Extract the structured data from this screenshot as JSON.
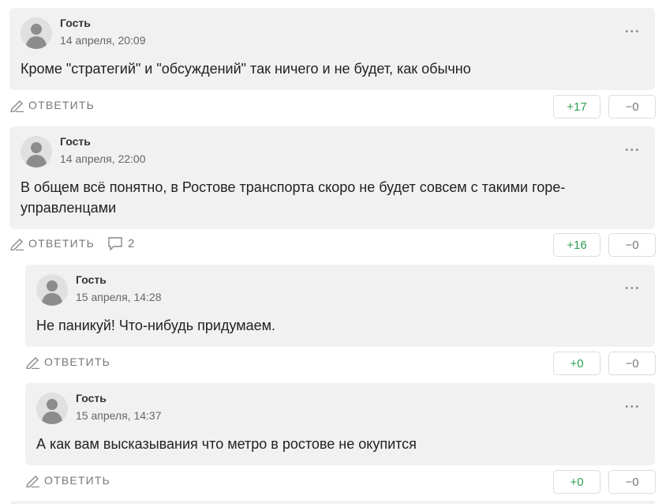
{
  "labels": {
    "reply": "ОТВЕТИТЬ",
    "menu": "•••"
  },
  "comments": [
    {
      "author": "Гость",
      "date": "14 апреля, 20:09",
      "text": "Кроме \"стратегий\" и \"обсуждений\" так ничего и не будет, как обычно",
      "up": "+17",
      "down": "−0"
    },
    {
      "author": "Гость",
      "date": "14 апреля, 22:00",
      "text": "В общем всё понятно, в Ростове транспорта скоро не будет совсем с такими горе-управленцами",
      "up": "+16",
      "down": "−0",
      "replies": "2"
    },
    {
      "author": "Гость",
      "date": "15 апреля, 14:28",
      "text": "Не паникуй! Что-нибудь придумаем.",
      "up": "+0",
      "down": "−0"
    },
    {
      "author": "Гость",
      "date": "15 апреля, 14:37",
      "text": "А как вам высказывания что метро в ростове не окупится",
      "up": "+0",
      "down": "−0"
    }
  ],
  "colors": {
    "bubble": "#f1f1f1",
    "upvote": "#2e9e52",
    "muted": "#777777"
  }
}
